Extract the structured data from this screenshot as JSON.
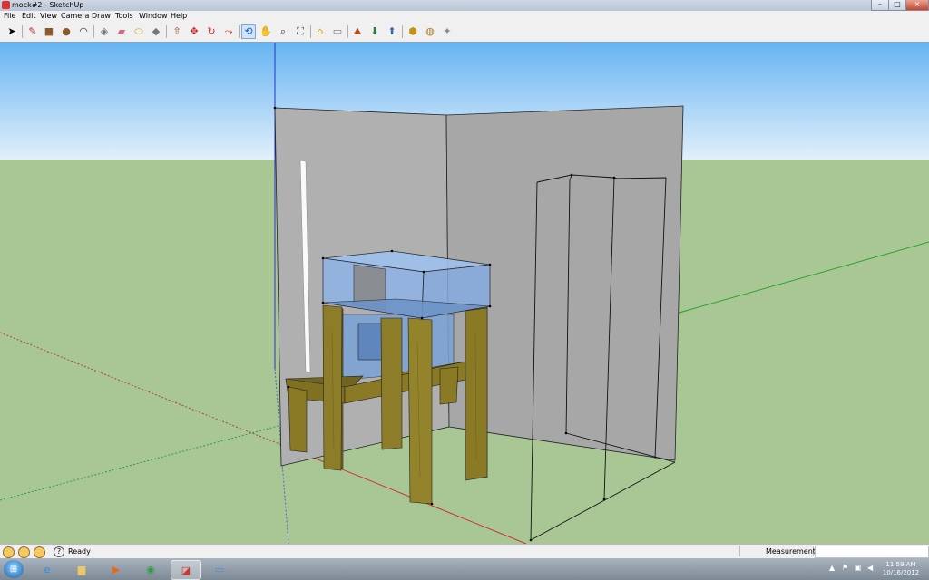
{
  "window": {
    "title": "mock#2 - SketchUp",
    "minimize": "–",
    "maximize": "□",
    "close": "×"
  },
  "menu": [
    "File",
    "Edit",
    "View",
    "Camera",
    "Draw",
    "Tools",
    "Window",
    "Help"
  ],
  "toolbar": [
    {
      "icon": "select-arrow-icon",
      "glyph": "➤"
    },
    {
      "icon": "pencil-line-icon",
      "glyph": "✎"
    },
    {
      "icon": "rectangle-icon",
      "glyph": "■"
    },
    {
      "icon": "circle-icon",
      "glyph": "●"
    },
    {
      "icon": "arc-icon",
      "glyph": "◠"
    },
    {
      "icon": "make-component-icon",
      "glyph": "◈"
    },
    {
      "icon": "eraser-icon",
      "glyph": "▰"
    },
    {
      "icon": "tape-measure-icon",
      "glyph": "⬭"
    },
    {
      "icon": "paint-bucket-icon",
      "glyph": "◆"
    },
    {
      "icon": "push-pull-icon",
      "glyph": "⇧"
    },
    {
      "icon": "move-icon",
      "glyph": "✥"
    },
    {
      "icon": "rotate-icon",
      "glyph": "↻"
    },
    {
      "icon": "follow-me-icon",
      "glyph": "⤳"
    },
    {
      "icon": "offset-icon",
      "glyph": "◎"
    },
    {
      "icon": "orbit-icon",
      "glyph": "⟲"
    },
    {
      "icon": "pan-hand-icon",
      "glyph": "✋"
    },
    {
      "icon": "zoom-icon",
      "glyph": "⌕"
    },
    {
      "icon": "zoom-extents-icon",
      "glyph": "⛶"
    },
    {
      "icon": "add-location-icon",
      "glyph": "⌂"
    },
    {
      "icon": "toggle-terrain-icon",
      "glyph": "▭"
    },
    {
      "icon": "google-earth-icon",
      "glyph": "⛰"
    },
    {
      "icon": "get-models-icon",
      "glyph": "⬇"
    },
    {
      "icon": "share-model-icon",
      "glyph": "⬆"
    },
    {
      "icon": "share-component-icon",
      "glyph": "⬢"
    },
    {
      "icon": "get-photo-texture-icon",
      "glyph": "◍"
    },
    {
      "icon": "extension-warehouse-icon",
      "glyph": "✦"
    },
    {
      "icon": "layout-icon",
      "glyph": "▤"
    }
  ],
  "status": {
    "text": "Ready",
    "measurements_label": "Measurements",
    "measurements_value": "",
    "help": "?"
  },
  "taskbar": {
    "apps": [
      {
        "icon": "internet-explorer-icon",
        "glyph": "e",
        "color": "#2b8ee0"
      },
      {
        "icon": "file-explorer-icon",
        "glyph": "▆",
        "color": "#e9c76a"
      },
      {
        "icon": "media-player-icon",
        "glyph": "▶",
        "color": "#e46b1a"
      },
      {
        "icon": "chrome-icon",
        "glyph": "◉",
        "color": "#2f9e44"
      },
      {
        "icon": "sketchup-icon",
        "glyph": "◪",
        "color": "#d2332f"
      },
      {
        "icon": "remote-desktop-icon",
        "glyph": "▭",
        "color": "#4a8fd0"
      }
    ],
    "time": "11:59 AM",
    "date": "10/16/2012"
  },
  "colors": {
    "sky_top": "#67b4f2",
    "sky_bottom": "#e2f0fb",
    "ground": "#a9c795",
    "wall": "#a7a7a7",
    "wood": "#8a7a26",
    "glass": "#8fb3e6"
  }
}
